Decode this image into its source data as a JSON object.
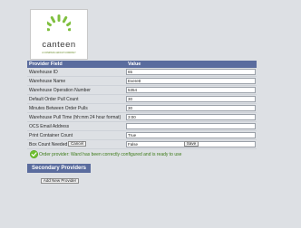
{
  "brand": {
    "name": "canteen",
    "tagline": "A COMPASS GROUP COMPANY",
    "accent_color": "#7fbf3f"
  },
  "form": {
    "header_field": "Provider Field",
    "header_value": "Value",
    "fields": [
      {
        "label": "Warehouse ID",
        "value": "65"
      },
      {
        "label": "Warehouse Name",
        "value": "Everett"
      },
      {
        "label": "Warehouse Operation Number",
        "value": "5354"
      },
      {
        "label": "Default Order Pull Count",
        "value": "30"
      },
      {
        "label": "Minutes Between Order Pulls",
        "value": "30"
      },
      {
        "label": "Warehouse Pull Time (hh:mm 24 hour format)",
        "value": "3:00"
      },
      {
        "label": "OCS Email Address",
        "value": ""
      },
      {
        "label": "Print Container Count",
        "value": "True"
      },
      {
        "label": "Box Count Needed",
        "value": "False"
      }
    ],
    "cancel_label": "Cancel",
    "save_label": "Save"
  },
  "status": {
    "message": "Order provider: Ward has been correctly configured and is ready to use",
    "color": "#3c7a18"
  },
  "secondary": {
    "title": "Secondary Providers",
    "add_label": "Add New Provider"
  }
}
